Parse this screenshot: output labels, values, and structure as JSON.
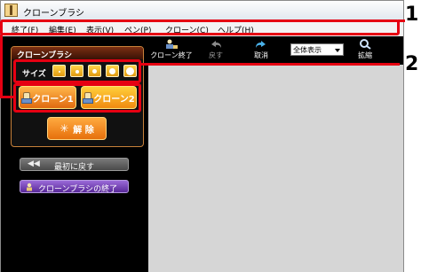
{
  "window": {
    "title": "クローンブラシ"
  },
  "menu": [
    "終了(F)",
    "編集(E)",
    "表示(V)",
    "ペン(P)",
    "クローン(C)",
    "ヘルプ(H)"
  ],
  "panel": {
    "title": "クローンブラシ",
    "size_label": "サイズ",
    "size_buttons": 5
  },
  "buttons": {
    "clone1": "クローン1",
    "clone2": "クローン2",
    "release": "解 除",
    "reset": "最初に戻す",
    "exit": "クローンブラシの終了"
  },
  "toolbar": {
    "clone_exit": "クローン終了",
    "undo": "戻す",
    "cancel": "取消",
    "view_select": "全体表示",
    "zoom": "拡縮"
  },
  "callouts": [
    "1",
    "2"
  ],
  "colors": {
    "callout": "#e60012",
    "panel_border": "#c8813a",
    "button_orange": "#f08a10",
    "exit_purple": "#5a2a9a"
  }
}
